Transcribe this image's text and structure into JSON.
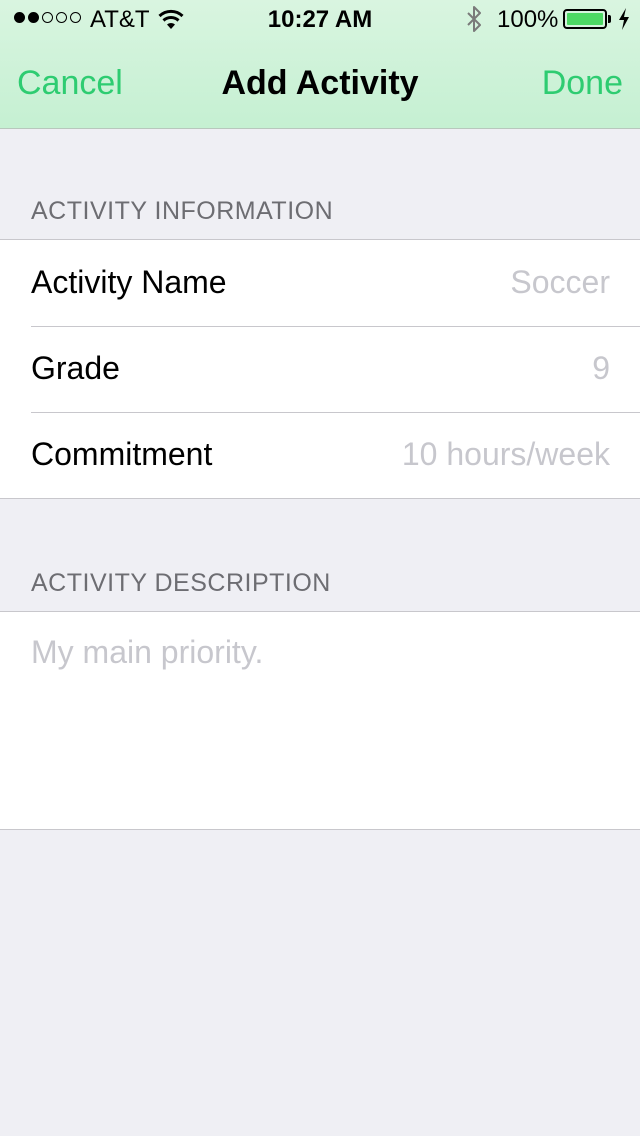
{
  "status_bar": {
    "carrier": "AT&T",
    "time": "10:27 AM",
    "battery_percent": "100%",
    "battery_level": 1.0,
    "signal_bars_filled": 2,
    "signal_bars_total": 5
  },
  "nav": {
    "cancel_label": "Cancel",
    "title": "Add Activity",
    "done_label": "Done"
  },
  "sections": {
    "info_header": "ACTIVITY INFORMATION",
    "description_header": "ACTIVITY DESCRIPTION"
  },
  "fields": {
    "activity_name": {
      "label": "Activity Name",
      "placeholder": "Soccer",
      "value": ""
    },
    "grade": {
      "label": "Grade",
      "placeholder": "9",
      "value": ""
    },
    "commitment": {
      "label": "Commitment",
      "placeholder": "10 hours/week",
      "value": ""
    }
  },
  "description": {
    "placeholder": "My main priority.",
    "value": ""
  },
  "colors": {
    "accent": "#2ecc71",
    "nav_background": "#c5f0d2",
    "page_background": "#efeff4",
    "battery_fill": "#4cd964"
  }
}
